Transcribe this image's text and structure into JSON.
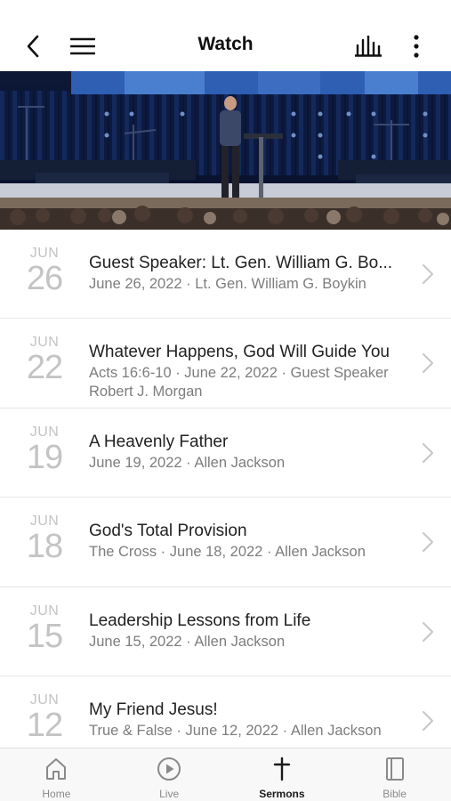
{
  "header": {
    "title": "Watch"
  },
  "sermons": [
    {
      "month": "JUN",
      "day": "26",
      "title": "Guest Speaker: Lt. Gen. William G. Bo...",
      "meta": "June 26, 2022 · Lt. Gen. William G. Boykin"
    },
    {
      "month": "JUN",
      "day": "22",
      "title": "Whatever Happens, God Will Guide You",
      "meta": "Acts 16:6-10 · June 22, 2022 · Guest Speaker Robert J. Morgan"
    },
    {
      "month": "JUN",
      "day": "19",
      "title": "A Heavenly Father",
      "meta": "June 19, 2022 · Allen Jackson"
    },
    {
      "month": "JUN",
      "day": "18",
      "title": "God's Total Provision",
      "meta": "The Cross · June 18, 2022 · Allen Jackson"
    },
    {
      "month": "JUN",
      "day": "15",
      "title": "Leadership Lessons from Life",
      "meta": "June 15, 2022 · Allen Jackson"
    },
    {
      "month": "JUN",
      "day": "12",
      "title": "My Friend Jesus!",
      "meta": "True & False · June 12, 2022 · Allen Jackson"
    }
  ],
  "tabs": [
    {
      "label": "Home",
      "icon": "home-icon"
    },
    {
      "label": "Live",
      "icon": "play-circle-icon"
    },
    {
      "label": "Sermons",
      "icon": "cross-icon",
      "active": true
    },
    {
      "label": "Bible",
      "icon": "book-icon"
    }
  ],
  "colors": {
    "accent": "#1a1a1a",
    "muted": "#7d7d7d",
    "date": "#c4c4c4"
  }
}
